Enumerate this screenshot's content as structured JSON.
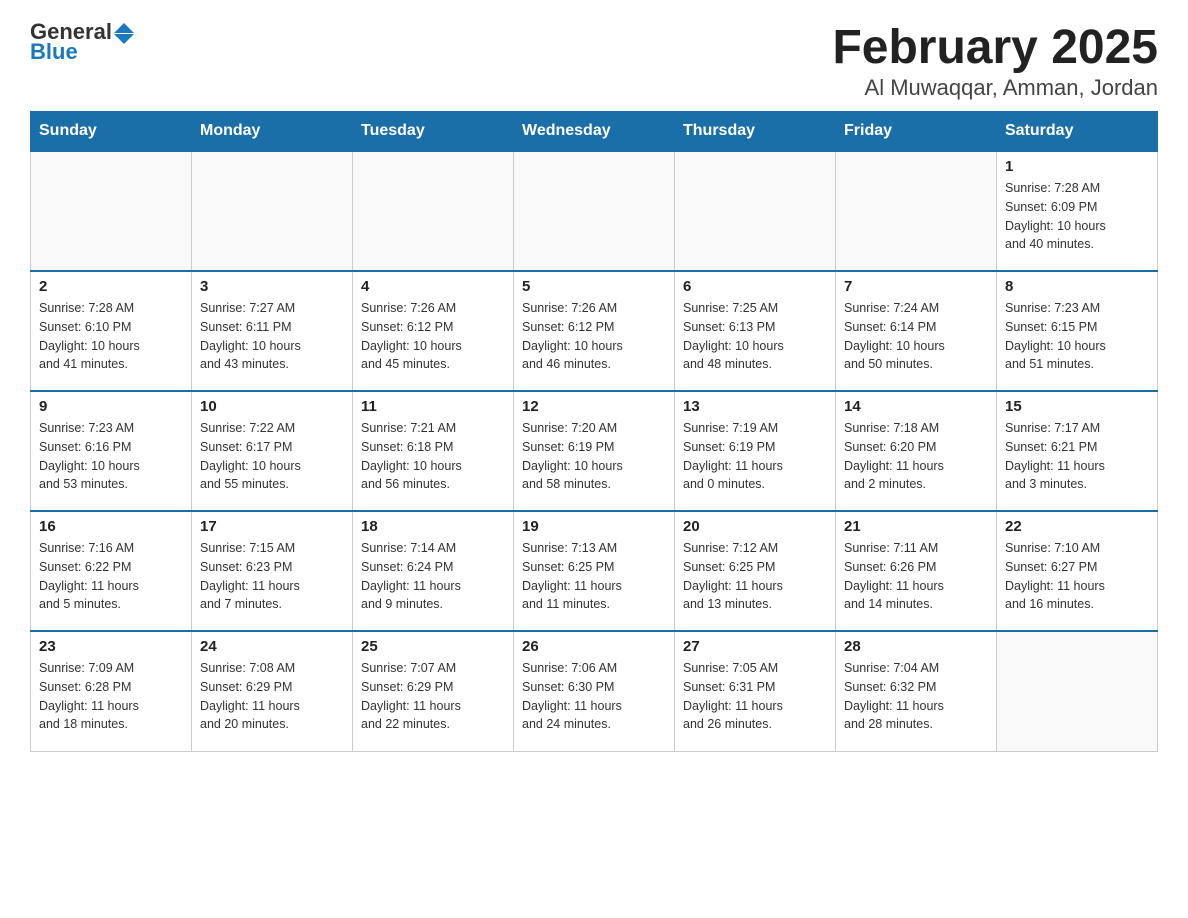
{
  "logo": {
    "general": "General",
    "blue": "Blue"
  },
  "title": "February 2025",
  "subtitle": "Al Muwaqqar, Amman, Jordan",
  "days_header": [
    "Sunday",
    "Monday",
    "Tuesday",
    "Wednesday",
    "Thursday",
    "Friday",
    "Saturday"
  ],
  "weeks": [
    [
      {
        "day": "",
        "info": ""
      },
      {
        "day": "",
        "info": ""
      },
      {
        "day": "",
        "info": ""
      },
      {
        "day": "",
        "info": ""
      },
      {
        "day": "",
        "info": ""
      },
      {
        "day": "",
        "info": ""
      },
      {
        "day": "1",
        "info": "Sunrise: 7:28 AM\nSunset: 6:09 PM\nDaylight: 10 hours\nand 40 minutes."
      }
    ],
    [
      {
        "day": "2",
        "info": "Sunrise: 7:28 AM\nSunset: 6:10 PM\nDaylight: 10 hours\nand 41 minutes."
      },
      {
        "day": "3",
        "info": "Sunrise: 7:27 AM\nSunset: 6:11 PM\nDaylight: 10 hours\nand 43 minutes."
      },
      {
        "day": "4",
        "info": "Sunrise: 7:26 AM\nSunset: 6:12 PM\nDaylight: 10 hours\nand 45 minutes."
      },
      {
        "day": "5",
        "info": "Sunrise: 7:26 AM\nSunset: 6:12 PM\nDaylight: 10 hours\nand 46 minutes."
      },
      {
        "day": "6",
        "info": "Sunrise: 7:25 AM\nSunset: 6:13 PM\nDaylight: 10 hours\nand 48 minutes."
      },
      {
        "day": "7",
        "info": "Sunrise: 7:24 AM\nSunset: 6:14 PM\nDaylight: 10 hours\nand 50 minutes."
      },
      {
        "day": "8",
        "info": "Sunrise: 7:23 AM\nSunset: 6:15 PM\nDaylight: 10 hours\nand 51 minutes."
      }
    ],
    [
      {
        "day": "9",
        "info": "Sunrise: 7:23 AM\nSunset: 6:16 PM\nDaylight: 10 hours\nand 53 minutes."
      },
      {
        "day": "10",
        "info": "Sunrise: 7:22 AM\nSunset: 6:17 PM\nDaylight: 10 hours\nand 55 minutes."
      },
      {
        "day": "11",
        "info": "Sunrise: 7:21 AM\nSunset: 6:18 PM\nDaylight: 10 hours\nand 56 minutes."
      },
      {
        "day": "12",
        "info": "Sunrise: 7:20 AM\nSunset: 6:19 PM\nDaylight: 10 hours\nand 58 minutes."
      },
      {
        "day": "13",
        "info": "Sunrise: 7:19 AM\nSunset: 6:19 PM\nDaylight: 11 hours\nand 0 minutes."
      },
      {
        "day": "14",
        "info": "Sunrise: 7:18 AM\nSunset: 6:20 PM\nDaylight: 11 hours\nand 2 minutes."
      },
      {
        "day": "15",
        "info": "Sunrise: 7:17 AM\nSunset: 6:21 PM\nDaylight: 11 hours\nand 3 minutes."
      }
    ],
    [
      {
        "day": "16",
        "info": "Sunrise: 7:16 AM\nSunset: 6:22 PM\nDaylight: 11 hours\nand 5 minutes."
      },
      {
        "day": "17",
        "info": "Sunrise: 7:15 AM\nSunset: 6:23 PM\nDaylight: 11 hours\nand 7 minutes."
      },
      {
        "day": "18",
        "info": "Sunrise: 7:14 AM\nSunset: 6:24 PM\nDaylight: 11 hours\nand 9 minutes."
      },
      {
        "day": "19",
        "info": "Sunrise: 7:13 AM\nSunset: 6:25 PM\nDaylight: 11 hours\nand 11 minutes."
      },
      {
        "day": "20",
        "info": "Sunrise: 7:12 AM\nSunset: 6:25 PM\nDaylight: 11 hours\nand 13 minutes."
      },
      {
        "day": "21",
        "info": "Sunrise: 7:11 AM\nSunset: 6:26 PM\nDaylight: 11 hours\nand 14 minutes."
      },
      {
        "day": "22",
        "info": "Sunrise: 7:10 AM\nSunset: 6:27 PM\nDaylight: 11 hours\nand 16 minutes."
      }
    ],
    [
      {
        "day": "23",
        "info": "Sunrise: 7:09 AM\nSunset: 6:28 PM\nDaylight: 11 hours\nand 18 minutes."
      },
      {
        "day": "24",
        "info": "Sunrise: 7:08 AM\nSunset: 6:29 PM\nDaylight: 11 hours\nand 20 minutes."
      },
      {
        "day": "25",
        "info": "Sunrise: 7:07 AM\nSunset: 6:29 PM\nDaylight: 11 hours\nand 22 minutes."
      },
      {
        "day": "26",
        "info": "Sunrise: 7:06 AM\nSunset: 6:30 PM\nDaylight: 11 hours\nand 24 minutes."
      },
      {
        "day": "27",
        "info": "Sunrise: 7:05 AM\nSunset: 6:31 PM\nDaylight: 11 hours\nand 26 minutes."
      },
      {
        "day": "28",
        "info": "Sunrise: 7:04 AM\nSunset: 6:32 PM\nDaylight: 11 hours\nand 28 minutes."
      },
      {
        "day": "",
        "info": ""
      }
    ]
  ]
}
